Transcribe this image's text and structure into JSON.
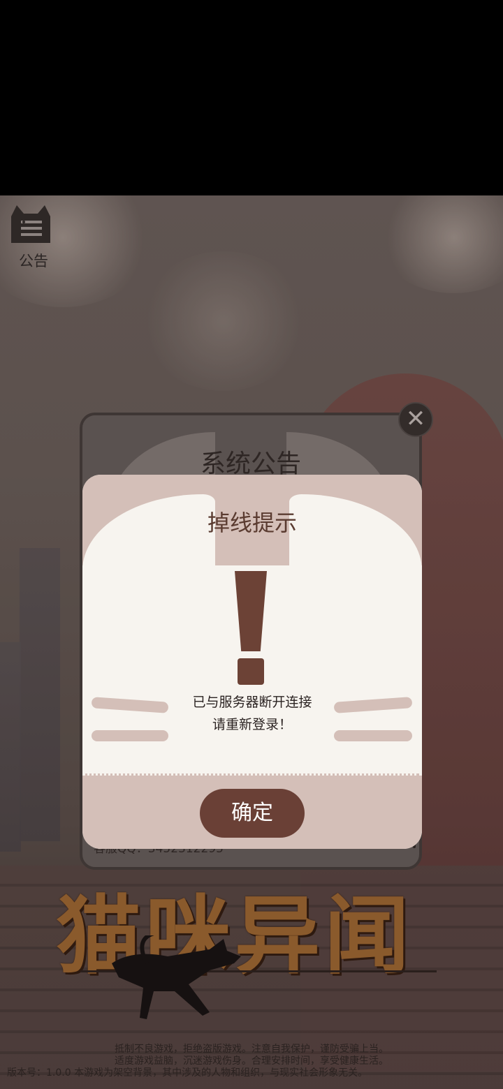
{
  "notice_button": {
    "label": "公告",
    "icon": "cat-menu-icon"
  },
  "system_notice": {
    "title": "系统公告",
    "contact": "客服QQ：3452312295",
    "close_symbol": "✕"
  },
  "dialog": {
    "title": "掉线提示",
    "icon": "exclamation-icon",
    "message_line1": "已与服务器断开连接",
    "message_line2": "请重新登录！",
    "confirm_label": "确定"
  },
  "logo": {
    "text": "猫咪异闻"
  },
  "footer": {
    "line1": "抵制不良游戏，拒绝盗版游戏。注意自我保护，谨防受骗上当。",
    "line2": "适度游戏益脑，沉迷游戏伤身。合理安排时间，享受健康生活。",
    "line3": "版本号：1.0.0  本游戏为架空背景，其中涉及的人物和组织，与现实社会形象无关。"
  },
  "colors": {
    "dialog_bg": "#f7f4ef",
    "dialog_accent": "#d4bfb8",
    "brown": "#6a4036"
  }
}
